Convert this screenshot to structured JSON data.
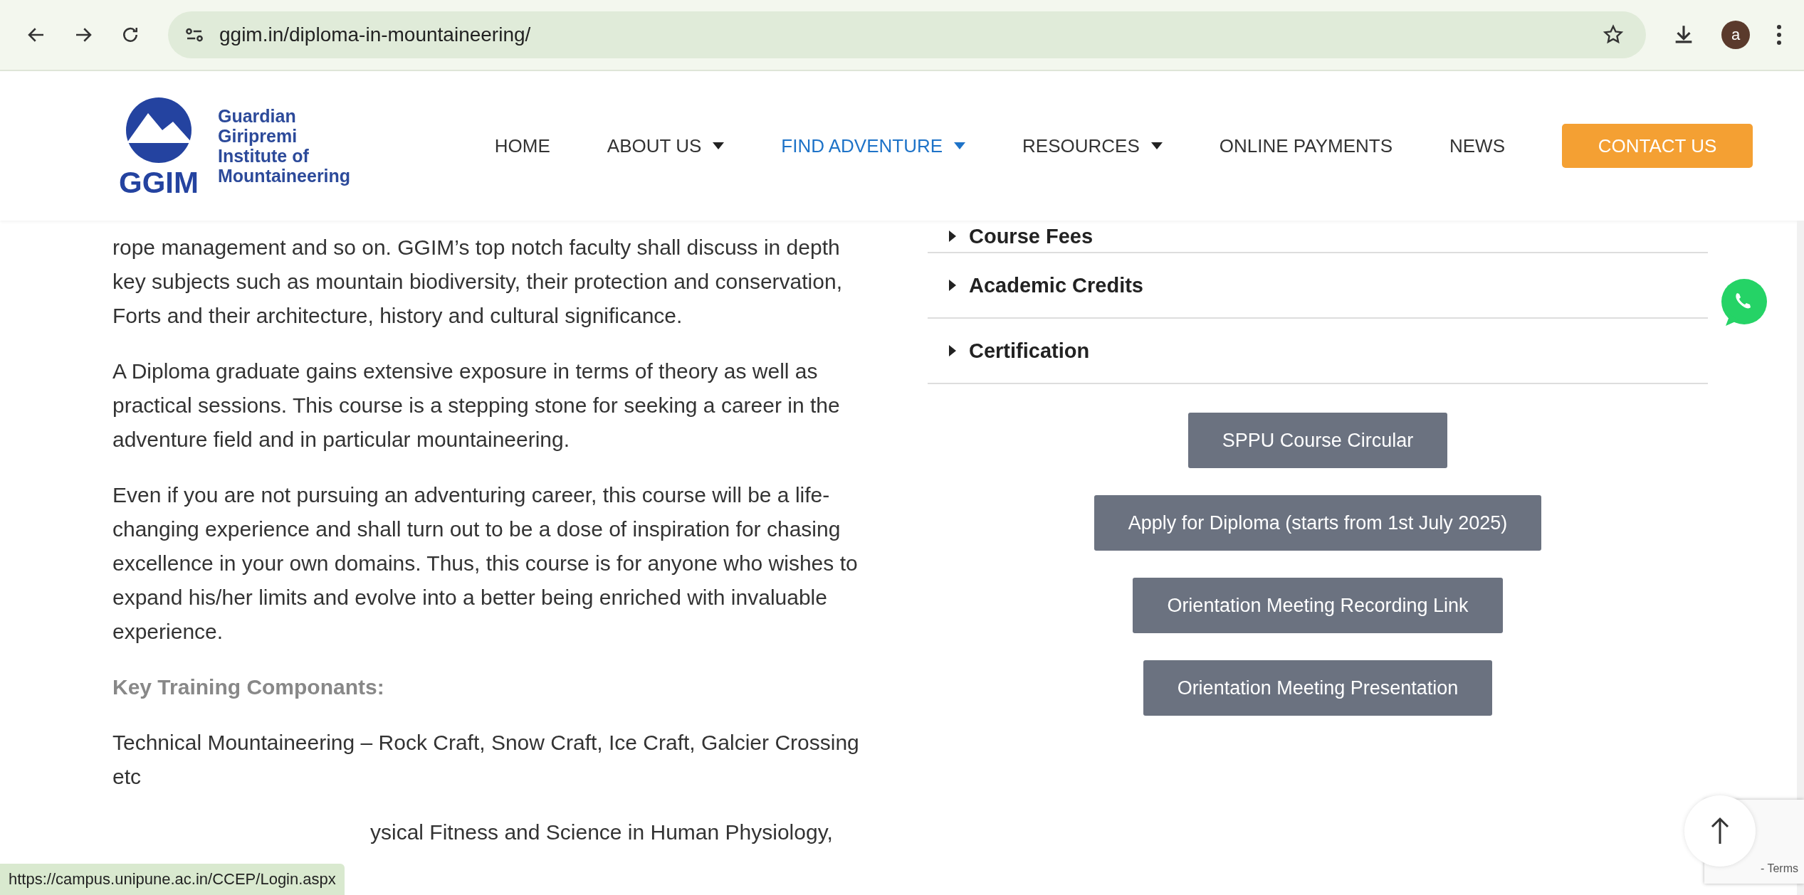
{
  "browser": {
    "url": "ggim.in/diploma-in-mountaineering/",
    "profile_initial": "a"
  },
  "header": {
    "logo_mark": "GGIM",
    "logo_lines": [
      "Guardian",
      "Giripremi",
      "Institute of",
      "Mountaineering"
    ],
    "nav": [
      {
        "label": "HOME",
        "dropdown": false,
        "selected": false
      },
      {
        "label": "ABOUT US",
        "dropdown": true,
        "selected": false
      },
      {
        "label": "FIND ADVENTURE",
        "dropdown": true,
        "selected": true
      },
      {
        "label": "RESOURCES",
        "dropdown": true,
        "selected": false
      },
      {
        "label": "ONLINE PAYMENTS",
        "dropdown": false,
        "selected": false
      },
      {
        "label": "NEWS",
        "dropdown": false,
        "selected": false
      }
    ],
    "contact_button": "CONTACT US"
  },
  "content": {
    "paragraphs": [
      {
        "kind": "text",
        "text": "rope management and so on. GGIM’s top notch faculty shall discuss in depth key subjects such as mountain biodiversity, their protection and conservation, Forts and their architecture, history and cultural significance."
      },
      {
        "kind": "text",
        "text": "A Diploma graduate gains extensive exposure in terms of theory as well as practical sessions. This course is a stepping stone for seeking a career in the adventure field and in particular mountaineering."
      },
      {
        "kind": "text",
        "text": "Even if you are not pursuing an adventuring career, this course will be a life-changing experience and shall turn out to be a dose of inspiration for chasing excellence in your own domains. Thus, this course is for anyone who wishes to expand his/her limits and evolve into a better being enriched with invaluable experience."
      },
      {
        "kind": "heading",
        "text": "Key Training Componants:"
      },
      {
        "kind": "text",
        "text": "Technical Mountaineering – Rock Craft, Snow Craft, Ice Craft, Galcier Crossing etc"
      },
      {
        "kind": "partial",
        "text": "ysical Fitness and Science in Human Physiology,"
      }
    ],
    "accordion": [
      {
        "label": "Course Fees",
        "expanded": false
      },
      {
        "label": "Academic Credits",
        "expanded": false
      },
      {
        "label": "Certification",
        "expanded": false
      }
    ],
    "buttons": [
      "SPPU Course Circular",
      "Apply for Diploma (starts from 1st July 2025)",
      "Orientation Meeting Recording Link",
      "Orientation Meeting Presentation"
    ]
  },
  "recaptcha": {
    "text": "- Terms"
  },
  "status_bar": "https://campus.unipune.ac.in/CCEP/Login.aspx"
}
